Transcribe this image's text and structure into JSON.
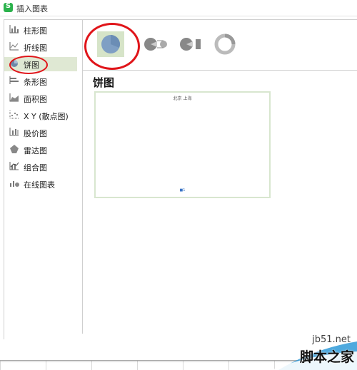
{
  "window": {
    "title": "插入图表",
    "app_icon": "spreadsheet-app-icon"
  },
  "sidebar": {
    "items": [
      {
        "label": "柱形图",
        "icon": "column-chart-icon"
      },
      {
        "label": "折线图",
        "icon": "line-chart-icon"
      },
      {
        "label": "饼图",
        "icon": "pie-chart-icon",
        "active": true
      },
      {
        "label": "条形图",
        "icon": "bar-chart-icon"
      },
      {
        "label": "面积图",
        "icon": "area-chart-icon"
      },
      {
        "label": "X Y (散点图)",
        "icon": "scatter-chart-icon"
      },
      {
        "label": "股价图",
        "icon": "stock-chart-icon"
      },
      {
        "label": "雷达图",
        "icon": "radar-chart-icon"
      },
      {
        "label": "组合图",
        "icon": "combo-chart-icon"
      },
      {
        "label": "在线图表",
        "icon": "online-chart-icon"
      }
    ]
  },
  "subtypes": [
    {
      "icon": "pie-icon",
      "selected": true
    },
    {
      "icon": "pie-of-pie-icon"
    },
    {
      "icon": "bar-of-pie-icon"
    },
    {
      "icon": "doughnut-icon"
    }
  ],
  "main": {
    "section_title": "饼图",
    "preview": {
      "title": "北京 上海",
      "legend": "■1"
    }
  },
  "watermark": {
    "url": "jb51.net",
    "brand": "脚本之家"
  },
  "colors": {
    "accent": "#2bb24c",
    "selected_bg": "#d6e4c8",
    "highlight": "#e0151a",
    "pie": "#7f9fc4"
  }
}
